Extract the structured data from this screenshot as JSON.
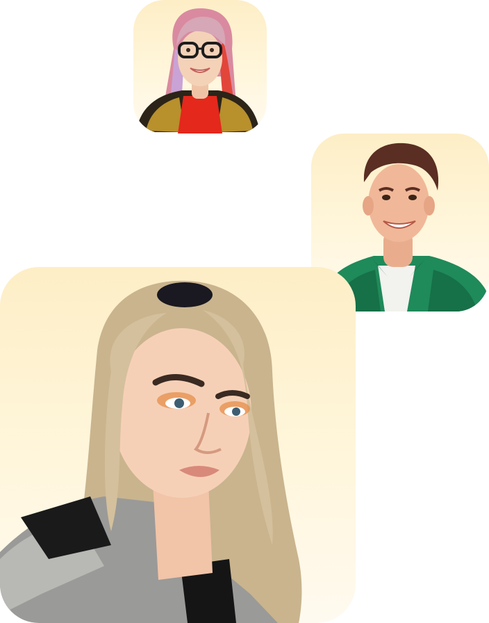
{
  "photos": [
    {
      "name": "portrait-woman-glasses",
      "subject": "person-photo"
    },
    {
      "name": "portrait-man-green-shirt",
      "subject": "person-photo"
    },
    {
      "name": "portrait-woman-blonde",
      "subject": "person-photo"
    }
  ],
  "colors": {
    "card_background_top": "#fdeec6",
    "card_background_bottom": "#fffaf0",
    "page_background": "#ffffff"
  }
}
